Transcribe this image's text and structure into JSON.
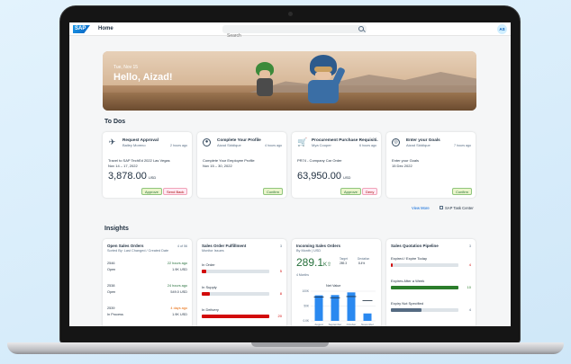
{
  "shell": {
    "logo": "SAP",
    "home": "Home",
    "search_placeholder": "Search",
    "avatar": "AS"
  },
  "hero": {
    "date": "Tue, Nov 15",
    "greeting": "Hello, Aizad!"
  },
  "todos_heading": "To Dos",
  "todos": [
    {
      "title": "Request Approval",
      "subtitle": "Bailey Moreno",
      "age": "2 hours ago",
      "desc1": "Travel to SAP TechEd 2022 Las Vegas",
      "desc2": "Nov 14 – 17, 2022",
      "amount": "3,878.00",
      "currency": "USD",
      "buttons": [
        "Approve",
        "Send Back"
      ]
    },
    {
      "title": "Complete Your Profile",
      "subtitle": "Aizad Siddique",
      "age": "4 hours ago",
      "desc1": "Complete Your Employee Profile",
      "desc2": "Nov 15 – 30, 2022",
      "buttons": [
        "Confirm"
      ]
    },
    {
      "title": "Procurement Purchase Requisiti...",
      "subtitle": "Mya Cooper",
      "age": "6 hours ago",
      "desc1": "PR74 - Company Car Order",
      "amount": "63,950.00",
      "currency": "USD",
      "buttons": [
        "Approve",
        "Deny"
      ]
    },
    {
      "title": "Enter your Goals",
      "subtitle": "Aizad Siddique",
      "age": "7 hours ago",
      "desc1": "Enter your Goals",
      "desc2": "15 Dec 2022",
      "buttons": [
        "Confirm"
      ]
    }
  ],
  "view_more": "View More",
  "task_center": "SAP Task Center",
  "insights_heading": "Insights",
  "open_orders": {
    "title": "Open Sales Orders",
    "count": "4 of 56",
    "subtitle": "Sorted By: Last Changed / Created Date",
    "rows": [
      {
        "id": "2546",
        "status": "Open",
        "time": "22 hours ago",
        "amount": "1.9K USD",
        "time_color": "#256f3a"
      },
      {
        "id": "2538",
        "status": "Open",
        "time": "24 hours ago",
        "amount": "549.0 USD",
        "time_color": "#256f3a"
      },
      {
        "id": "2539",
        "status": "In Process",
        "time": "4 days ago",
        "amount": "1.9K USD",
        "time_color": "#e76500"
      }
    ]
  },
  "fulfillment": {
    "title": "Sales Order Fulfillment",
    "subtitle": "Monitor Issues",
    "count": "3",
    "bars": [
      {
        "label": "In Order",
        "value": "5",
        "fraction": 0.06,
        "color": "#d20a0a"
      },
      {
        "label": "In Supply",
        "value": "8",
        "fraction": 0.12,
        "color": "#d20a0a"
      },
      {
        "label": "In Delivery",
        "value": "20",
        "fraction": 1.0,
        "color": "#d20a0a"
      }
    ]
  },
  "incoming": {
    "title": "Incoming Sales Orders",
    "subtitle": "By Month | USD",
    "value": "289.1",
    "unit": "K",
    "target_label": "Target",
    "target_value": "289.3",
    "deviation_label": "Deviation",
    "deviation_value": "8.4%",
    "months": "4 Months",
    "chart_title": "Net Value",
    "y_ticks": [
      "100K",
      "50K",
      "0.0K"
    ],
    "chart_data": {
      "type": "bar",
      "categories": [
        "August",
        "September",
        "October",
        "November"
      ],
      "values": [
        86,
        87,
        96,
        25
      ],
      "targets": [
        80,
        78,
        82,
        68
      ],
      "ylim": [
        0,
        100
      ]
    }
  },
  "pipeline": {
    "title": "Sales Quotation Pipeline",
    "count": "3",
    "bars": [
      {
        "label": "Expired / Expire Today",
        "value": "4",
        "fraction": 0.03,
        "color": "#d20a0a"
      },
      {
        "label": "Expires After a Week",
        "value": "10",
        "fraction": 1.0,
        "color": "#2b7d2b"
      },
      {
        "label": "Expiry Not Specified",
        "value": "4",
        "fraction": 0.45,
        "color": "#556b82"
      }
    ]
  }
}
